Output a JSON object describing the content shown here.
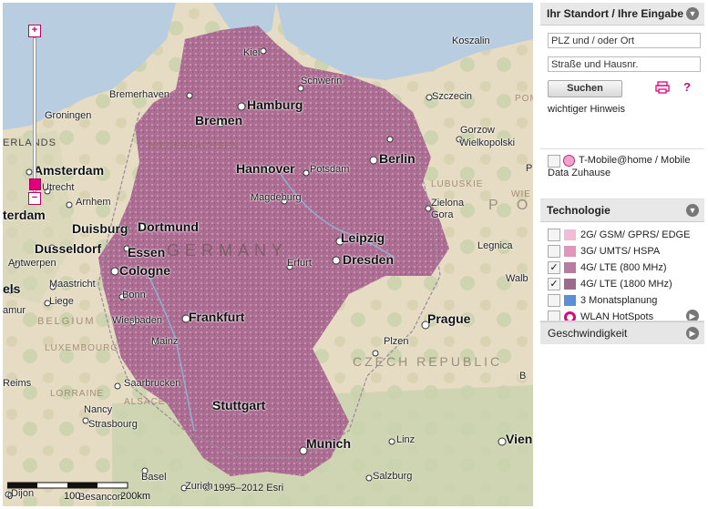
{
  "map": {
    "zoom_plus": "+",
    "zoom_minus": "−",
    "copyright": "© 1995–2012 Esri",
    "scale": {
      "zero": "0",
      "mid": "100",
      "end": "200km"
    },
    "countries": {
      "germany": "GERMANY",
      "czech": "CZECH REPUBLIC",
      "belgium": "BELGIUM",
      "luxembourg": "LUXEMBOURG",
      "netherlands": "ERLANDS",
      "poland_partial": "P O",
      "pom": "POM"
    },
    "regions": {
      "niedersachsen": "NIEDERSACHSEN",
      "lubuskie": "LUBUSKIE",
      "lorraine": "LORRAINE",
      "alsace": "ALSACE",
      "wie": "WIE",
      "p": "P"
    },
    "cities": {
      "koszalin": "Koszalin",
      "kiel": "Kiel",
      "schwerin": "Schwerin",
      "bremerhaven": "Bremerhaven",
      "hamburg": "Hamburg",
      "szczecin": "Szczecin",
      "groningen": "Groningen",
      "bremen": "Bremen",
      "gorzow": "Gorzow",
      "wielkopolski": "Wielkopolski",
      "amsterdam": "Amsterdam",
      "utrecht": "Utrecht",
      "hannover": "Hannover",
      "potsdam": "Potsdam",
      "berlin": "Berlin",
      "arnhem": "Arnhem",
      "terdam": "terdam",
      "magdeburg": "Magdeburg",
      "zielona": "Zielona",
      "gora": "Gora",
      "duisburg": "Duisburg",
      "dortmund": "Dortmund",
      "dusseldorf": "Dusseldorf",
      "essen": "Essen",
      "leipzig": "Leipzig",
      "legnica": "Legnica",
      "antwerpen": "Antwerpen",
      "dresden": "Dresden",
      "cologne": "Cologne",
      "erfurt": "Erfurt",
      "els": "els",
      "maastricht": "Maastricht",
      "walb": "Walb",
      "bonn": "Bonn",
      "liege": "Liege",
      "amur": "amur",
      "frankfurt": "Frankfurt",
      "prague": "Prague",
      "wiesbaden": "Wiesbaden",
      "mainz": "Mainz",
      "plzen": "Plzen",
      "saarbrucken": "Saarbrucken",
      "reims": "Reims",
      "nancy": "Nancy",
      "strasbourg": "Strasbourg",
      "stuttgart": "Stuttgart",
      "zlin_partial": "B",
      "linz": "Linz",
      "munich": "Munich",
      "vienna": "Vien",
      "basel": "Basel",
      "zurich": "Zurich",
      "salzburg": "Salzburg",
      "dijon": "Dijon",
      "besancon": "Besancon"
    }
  },
  "panel": {
    "header_location": "Ihr Standort / Ihre Eingabe",
    "input_plz": "PLZ und / oder Ort",
    "input_street": "Straße und Hausnr.",
    "search_label": "Suchen",
    "hint_label": "wichtiger Hinweis",
    "home_label": "T-Mobile@home / Mobile Data Zuhause",
    "header_technology": "Technologie",
    "tech_items": [
      {
        "label": "2G/ GSM/ GPRS/ EDGE",
        "checked": false,
        "color": "#f2bcd6"
      },
      {
        "label": "3G/ UMTS/ HSPA",
        "checked": false,
        "color": "#e495bd"
      },
      {
        "label": "4G/ LTE (800 MHz)",
        "checked": true,
        "color": "#b87ba1"
      },
      {
        "label": "4G/ LTE (1800 MHz)",
        "checked": true,
        "color": "#9c6b8e"
      },
      {
        "label": "3 Monatsplanung",
        "checked": false,
        "color": "#5b8fd6"
      },
      {
        "label": "WLAN HotSpots",
        "checked": false,
        "color": "#e2007a"
      }
    ],
    "header_speed": "Geschwindigkeit",
    "checkmark": "✓"
  },
  "colors": {
    "accent": "#e2007a",
    "coverage": "#a8648f"
  }
}
